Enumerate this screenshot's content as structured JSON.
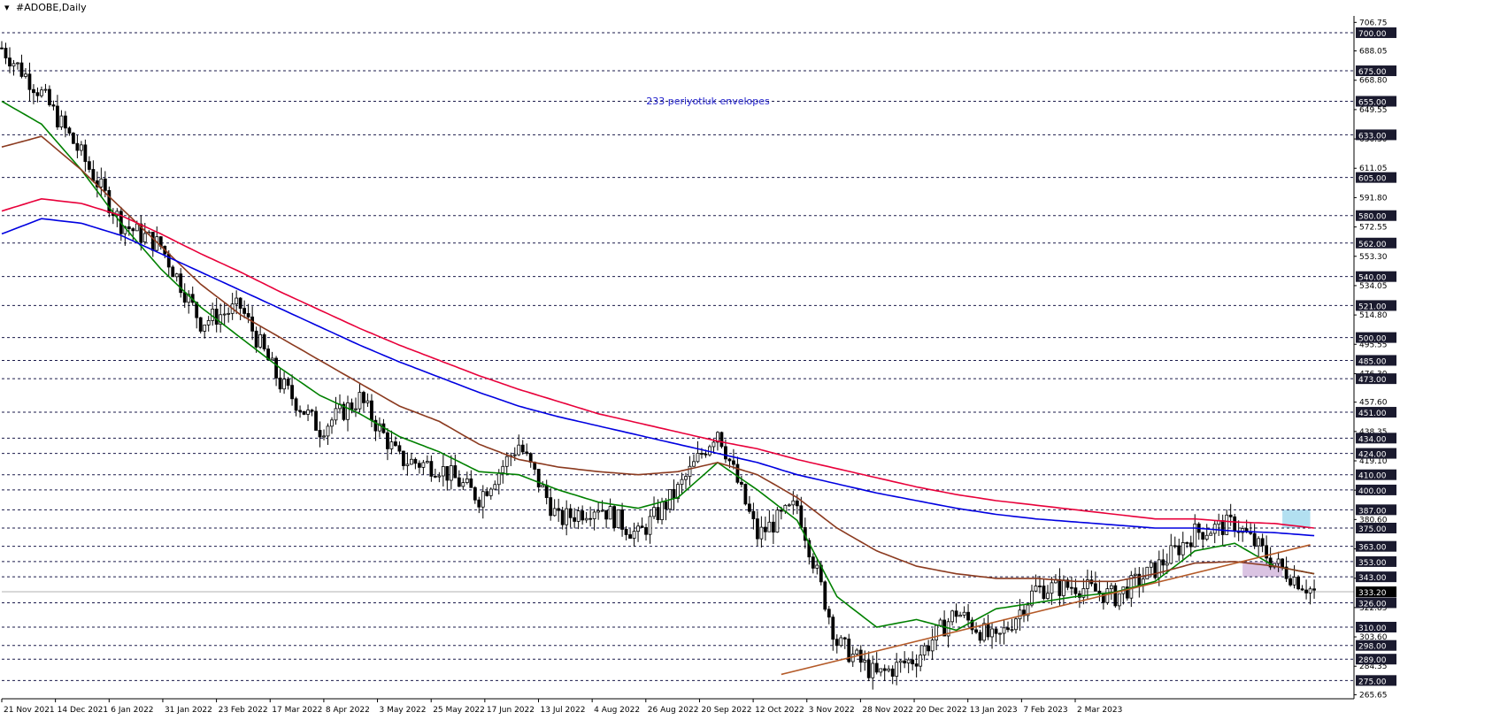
{
  "window": {
    "title": "#ADOBE,Daily",
    "menu_icon": "triangle-down-icon"
  },
  "chart_data": {
    "type": "candlestick",
    "symbol": "#ADOBE",
    "timeframe": "Daily",
    "annotation": "233 periyotluk envelopes",
    "last_price": 333.2,
    "ylim": [
      263,
      711
    ],
    "y_ticks": [
      706.75,
      688.05,
      668.8,
      649.55,
      630.3,
      611.05,
      591.8,
      572.55,
      553.3,
      534.05,
      514.8,
      495.55,
      476.3,
      457.6,
      438.35,
      419.1,
      399.85,
      380.6,
      361.35,
      342.1,
      322.85,
      303.6,
      284.35,
      265.65
    ],
    "level_lines": [
      700.0,
      675.0,
      655.0,
      633.0,
      605.0,
      580.0,
      562.0,
      540.0,
      521.0,
      500.0,
      485.0,
      473.0,
      451.0,
      434.0,
      424.0,
      410.0,
      400.0,
      387.0,
      375.0,
      363.0,
      353.0,
      343.0,
      326.0,
      310.0,
      298.0,
      289.0,
      275.0
    ],
    "x_labels": [
      "21 Nov 2021",
      "14 Dec 2021",
      "6 Jan 2022",
      "31 Jan 2022",
      "23 Feb 2022",
      "17 Mar 2022",
      "8 Apr 2022",
      "3 May 2022",
      "25 May 2022",
      "17 Jun 2022",
      "13 Jul 2022",
      "4 Aug 2022",
      "26 Aug 2022",
      "20 Sep 2022",
      "12 Oct 2022",
      "3 Nov 2022",
      "28 Nov 2022",
      "20 Dec 2022",
      "13 Jan 2023",
      "7 Feb 2023",
      "2 Mar 2023"
    ],
    "series": [
      {
        "role": "price_ohlc_close",
        "x": [
          0,
          10,
          20,
          30,
          40,
          50,
          60,
          70,
          80,
          90,
          100,
          110,
          120,
          130,
          140,
          150,
          160,
          170,
          180,
          190,
          200,
          210,
          220,
          230,
          240,
          250,
          260,
          270,
          280,
          290,
          300,
          310,
          320,
          330
        ],
        "values": [
          690,
          660,
          620,
          575,
          560,
          510,
          520,
          470,
          440,
          460,
          420,
          415,
          395,
          430,
          380,
          390,
          370,
          400,
          440,
          370,
          390,
          300,
          278,
          290,
          320,
          300,
          335,
          337,
          330,
          348,
          372,
          378,
          352,
          333
        ]
      },
      {
        "role": "moving_average",
        "color": "#008000",
        "x": [
          0,
          10,
          20,
          30,
          40,
          50,
          60,
          70,
          80,
          90,
          100,
          110,
          120,
          130,
          140,
          150,
          160,
          170,
          180,
          190,
          200,
          210,
          220,
          230,
          240,
          250,
          260,
          270,
          280,
          290,
          300,
          310,
          320,
          330
        ],
        "values": [
          655,
          640,
          610,
          575,
          545,
          520,
          500,
          480,
          462,
          450,
          435,
          425,
          412,
          410,
          400,
          392,
          388,
          395,
          418,
          400,
          380,
          330,
          310,
          315,
          308,
          322,
          326,
          330,
          333,
          340,
          360,
          365,
          350,
          345
        ]
      },
      {
        "role": "moving_average",
        "color": "#8b3a1f",
        "x": [
          0,
          10,
          20,
          30,
          40,
          50,
          60,
          70,
          80,
          90,
          100,
          110,
          120,
          130,
          140,
          150,
          160,
          170,
          180,
          190,
          200,
          210,
          220,
          230,
          240,
          250,
          260,
          270,
          280,
          290,
          300,
          310,
          320,
          330
        ],
        "values": [
          625,
          632,
          610,
          585,
          560,
          535,
          515,
          500,
          485,
          470,
          455,
          445,
          430,
          420,
          415,
          412,
          410,
          412,
          418,
          410,
          395,
          375,
          360,
          350,
          345,
          342,
          342,
          340,
          340,
          345,
          352,
          353,
          350,
          345
        ]
      },
      {
        "role": "envelope_upper",
        "color": "#e8003a",
        "x": [
          0,
          10,
          20,
          30,
          40,
          50,
          60,
          70,
          80,
          90,
          100,
          110,
          120,
          130,
          140,
          150,
          160,
          170,
          180,
          190,
          200,
          210,
          220,
          230,
          240,
          250,
          260,
          270,
          280,
          290,
          300,
          310,
          320,
          330
        ],
        "values": [
          583,
          591,
          588,
          580,
          568,
          555,
          543,
          530,
          518,
          506,
          495,
          485,
          475,
          466,
          458,
          450,
          444,
          438,
          432,
          427,
          420,
          414,
          408,
          402,
          397,
          393,
          390,
          387,
          384,
          381,
          381,
          379,
          378,
          375
        ]
      },
      {
        "role": "envelope_lower",
        "color": "#0000e0",
        "x": [
          0,
          10,
          20,
          30,
          40,
          50,
          60,
          70,
          80,
          90,
          100,
          110,
          120,
          130,
          140,
          150,
          160,
          170,
          180,
          190,
          200,
          210,
          220,
          230,
          240,
          250,
          260,
          270,
          280,
          290,
          300,
          310,
          320,
          330
        ],
        "values": [
          568,
          578,
          575,
          567,
          555,
          543,
          531,
          519,
          507,
          495,
          484,
          474,
          464,
          455,
          448,
          442,
          436,
          430,
          424,
          418,
          410,
          404,
          398,
          393,
          388,
          384,
          381,
          379,
          377,
          375,
          375,
          373,
          372,
          370
        ]
      }
    ],
    "trendline": {
      "color": "#b45a28",
      "from": [
        196,
        279
      ],
      "to": [
        329,
        364
      ]
    },
    "zones": [
      {
        "color": "#a6dbef",
        "from_x": 322,
        "to_x": 329,
        "y_range": [
          375,
          387
        ]
      },
      {
        "color": "#d3b9dd",
        "from_x": 312,
        "to_x": 322,
        "y_range": [
          343,
          353
        ]
      }
    ],
    "grid": false,
    "legend": "none"
  }
}
